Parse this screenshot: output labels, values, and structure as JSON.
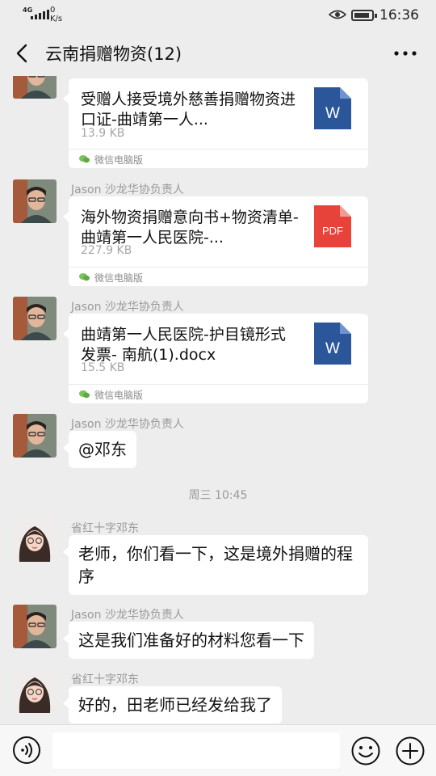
{
  "status_bar": {
    "network": "4G",
    "speed_value": "0",
    "speed_unit": "K/s",
    "time": "16:36"
  },
  "header": {
    "title": "云南捐赠物资(12)",
    "back_icon": "chevron-left-icon",
    "more_icon": "more-dots-icon"
  },
  "messages": [
    {
      "type": "file",
      "file_name": "受赠人接受境外慈善捐赠物资进口证-曲靖第一人...",
      "file_size": "13.9 KB",
      "file_type": "word",
      "icon_label": "W",
      "source": "微信电脑版"
    },
    {
      "type": "file",
      "sender": "Jason 沙龙华协负责人",
      "file_name": "海外物资捐赠意向书+物资清单-曲靖第一人民医院-...",
      "file_size": "227.9 KB",
      "file_type": "pdf",
      "icon_label": "PDF",
      "source": "微信电脑版"
    },
    {
      "type": "file",
      "sender": "Jason 沙龙华协负责人",
      "file_name": "曲靖第一人民医院-护目镜形式发票- 南航(1).docx",
      "file_size": "15.5 KB",
      "file_type": "word",
      "icon_label": "W",
      "source": "微信电脑版"
    },
    {
      "type": "text",
      "sender": "Jason 沙龙华协负责人",
      "text": "@邓东"
    },
    {
      "type": "timestamp",
      "text": "周三 10:45"
    },
    {
      "type": "text",
      "sender": "省红十字邓东",
      "text": "老师，你们看一下，这是境外捐赠的程序"
    },
    {
      "type": "text",
      "sender": "Jason 沙龙华协负责人",
      "text": "这是我们准备好的材料您看一下"
    },
    {
      "type": "text",
      "sender": "省红十字邓东",
      "text": "好的，田老师已经发给我了"
    }
  ],
  "input_bar": {
    "placeholder": "",
    "voice_icon": "voice-icon",
    "emoji_icon": "emoji-icon",
    "plus_icon": "plus-icon"
  },
  "colors": {
    "background": "#ededed",
    "bubble": "#ffffff",
    "word_icon": "#2b579a",
    "pdf_icon": "#e8433b",
    "meta_text": "#9a9a9a"
  }
}
